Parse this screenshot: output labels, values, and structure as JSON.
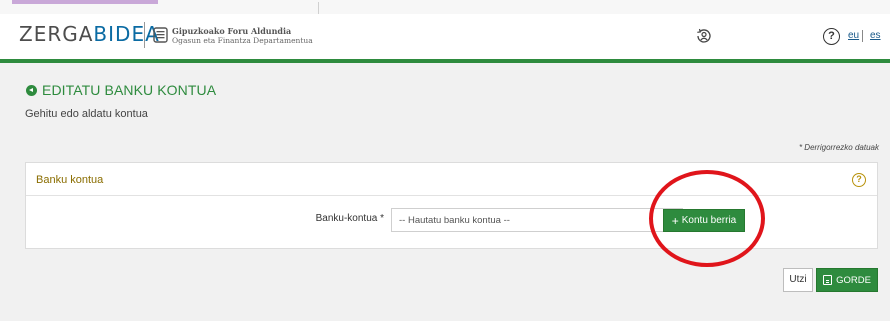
{
  "header": {
    "logo_part1": "ZERGA",
    "logo_part2": "BIDEA",
    "org_title": "Gipuzkoako Foru Aldundia",
    "org_subtitle": "Ogasun eta Finantza Departamentua",
    "help_glyph": "?",
    "languages": [
      "eu",
      "es"
    ]
  },
  "page": {
    "title": "EDITATU BANKU KONTUA",
    "subtitle": "Gehitu edo aldatu kontua",
    "required_note": "* Derrigorrezko datuak"
  },
  "panel": {
    "title": "Banku kontua",
    "help_glyph": "?",
    "field_label": "Banku-kontua *",
    "select_placeholder": "-- Hautatu banku kontua --",
    "new_button_label": "Kontu berria",
    "new_button_icon": "+"
  },
  "actions": {
    "cancel_label": "Utzi",
    "save_label": "GORDE"
  },
  "colors": {
    "brand_green": "#2e8b3e",
    "panel_title": "#8a6d00",
    "annotation_red": "#e0151b",
    "logo_blue": "#0b6ba3"
  },
  "icons": [
    "user-sync-icon",
    "help-icon",
    "back-arrow-icon",
    "help-circle-icon",
    "plus-icon",
    "save-icon",
    "shield-icon"
  ]
}
